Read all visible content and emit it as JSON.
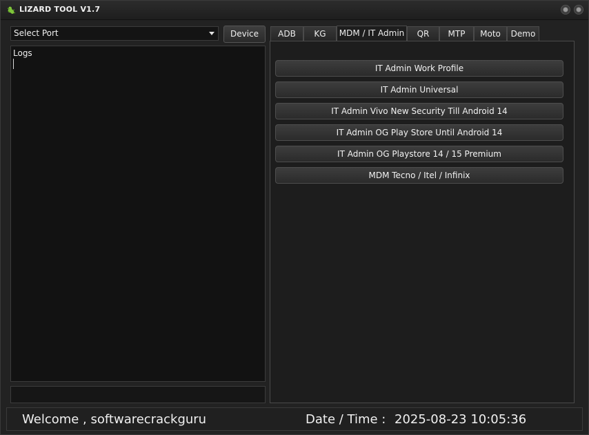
{
  "window": {
    "title": "LIZARD TOOL V1.7",
    "app_icon": "lizard-icon",
    "colors": {
      "background": "#222222",
      "accent_icon": "#7ec43a"
    }
  },
  "port": {
    "selected": "Select Port"
  },
  "device_button": {
    "label": "Device"
  },
  "logs": {
    "label": "Logs"
  },
  "tabs": [
    {
      "label": "ADB",
      "active": false
    },
    {
      "label": "KG",
      "active": false
    },
    {
      "label": "MDM / IT Admin",
      "active": true
    },
    {
      "label": "QR",
      "active": false
    },
    {
      "label": "MTP",
      "active": false
    },
    {
      "label": "Moto",
      "active": false
    },
    {
      "label": "Demo",
      "active": false
    }
  ],
  "actions": [
    {
      "label": "IT Admin Work Profile"
    },
    {
      "label": "IT Admin Universal"
    },
    {
      "label": "IT Admin Vivo New Security Till Android 14"
    },
    {
      "label": "IT Admin OG Play Store Until Android 14"
    },
    {
      "label": "IT Admin OG Playstore 14 / 15 Premium"
    },
    {
      "label": "MDM Tecno / Itel / Infinix"
    }
  ],
  "status": {
    "welcome": "Welcome , softwarecrackguru",
    "datetime_label": "Date / Time :",
    "datetime_value": "2025-08-23 10:05:36"
  }
}
